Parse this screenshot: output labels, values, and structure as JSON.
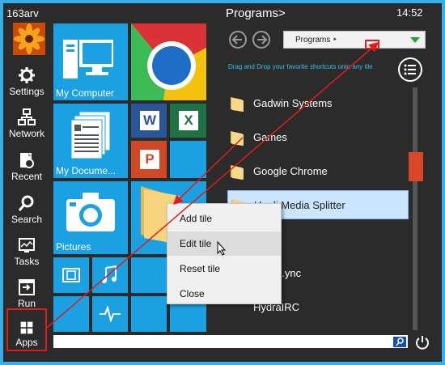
{
  "user": {
    "name": "163arv"
  },
  "sidebar": {
    "items": [
      {
        "label": "Settings",
        "icon": "gear-icon"
      },
      {
        "label": "Network",
        "icon": "network-icon"
      },
      {
        "label": "Recent",
        "icon": "recent-icon"
      },
      {
        "label": "Search",
        "icon": "search-icon"
      },
      {
        "label": "Tasks",
        "icon": "tasks-icon"
      },
      {
        "label": "Run",
        "icon": "run-icon"
      },
      {
        "label": "Apps",
        "icon": "apps-grid-icon"
      }
    ]
  },
  "tiles": {
    "my_computer": "My Computer",
    "my_documents": "My Docume...",
    "pictures": "Pictures"
  },
  "programs": {
    "title": "Programs>",
    "clock": "14:52",
    "dropdown_value": "Programs ‣",
    "hint": "Drag and Drop your favorite shortcuts onto any tile",
    "items": [
      {
        "name": "Gadwin Systems"
      },
      {
        "name": "Games"
      },
      {
        "name": "Google Chrome"
      },
      {
        "name": "Haali Media Splitter"
      },
      {
        "name": ""
      },
      {
        "name": "...ync"
      },
      {
        "name": "HydraIRC"
      }
    ]
  },
  "context_menu": {
    "items": [
      "Add tile",
      "Edit tile",
      "Reset tile",
      "Close"
    ]
  },
  "colors": {
    "background": "#3aaee5",
    "panel": "#2b2b2b",
    "tile_blue": "#1ba1e2",
    "annotation_red": "#e21b1b",
    "scroll_thumb": "#d94628"
  }
}
